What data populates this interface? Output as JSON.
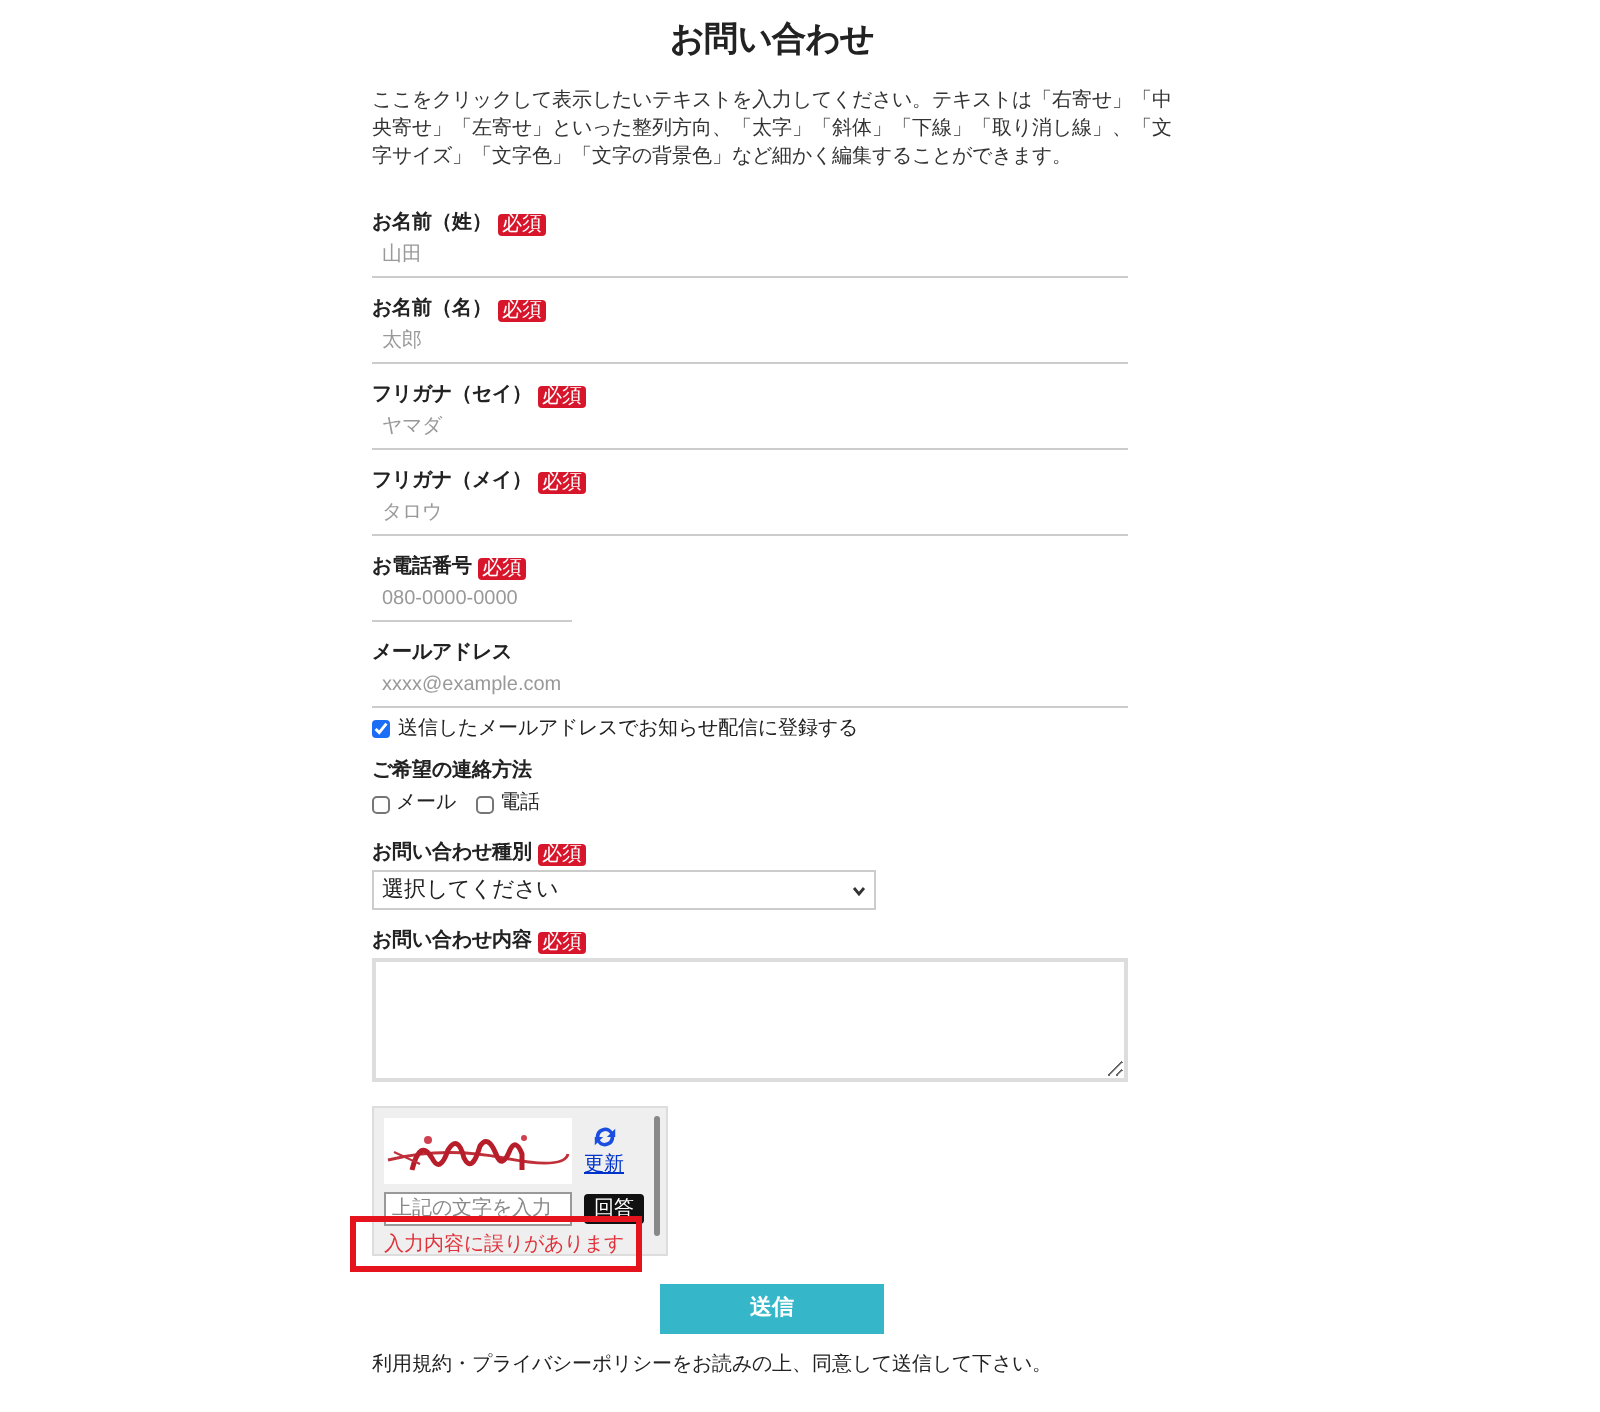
{
  "title": "お問い合わせ",
  "intro": "ここをクリックして表示したいテキストを入力してください。テキストは「右寄せ」「中央寄せ」「左寄せ」といった整列方向、「太字」「斜体」「下線」「取り消し線」、「文字サイズ」「文字色」「文字の背景色」など細かく編集することができます。",
  "fields": [
    {
      "kind": "text",
      "label": "お名前（姓）",
      "badge": "必須",
      "placeholder": "山田"
    },
    {
      "kind": "text",
      "label": "お名前（名）",
      "badge": "必須",
      "placeholder": "太郎"
    },
    {
      "kind": "text",
      "label": "フリガナ（セイ）",
      "badge": "必須",
      "placeholder": "ヤマダ"
    },
    {
      "kind": "text",
      "label": "フリガナ（メイ）",
      "badge": "必須",
      "placeholder": "タロウ"
    },
    {
      "kind": "tel",
      "label": "お電話番号",
      "badge": "必須",
      "placeholder": "080-0000-0000"
    },
    {
      "kind": "email",
      "label": "メールアドレス",
      "placeholder": "xxxx@example.com",
      "opt_in": {
        "label": "送信したメールアドレスでお知らせ配信に登録する",
        "checked": true
      }
    },
    {
      "kind": "choices",
      "label": "ご希望の連絡方法",
      "options": [
        {
          "label": "メール",
          "checked": false
        },
        {
          "label": "電話",
          "checked": false
        }
      ]
    },
    {
      "kind": "select",
      "label": "お問い合わせ種別",
      "badge": "必須",
      "value": "選択してください"
    },
    {
      "kind": "textarea",
      "label": "お問い合わせ内容",
      "badge": "必須"
    }
  ],
  "captcha": {
    "refresh_label": "更新",
    "placeholder": "上記の文字を入力",
    "answer_button": "回答",
    "error": "入力内容に誤りがあります"
  },
  "submit": "送信",
  "note": "利用規約・プライバシーポリシーをお読みの上、同意して送信して下さい。"
}
